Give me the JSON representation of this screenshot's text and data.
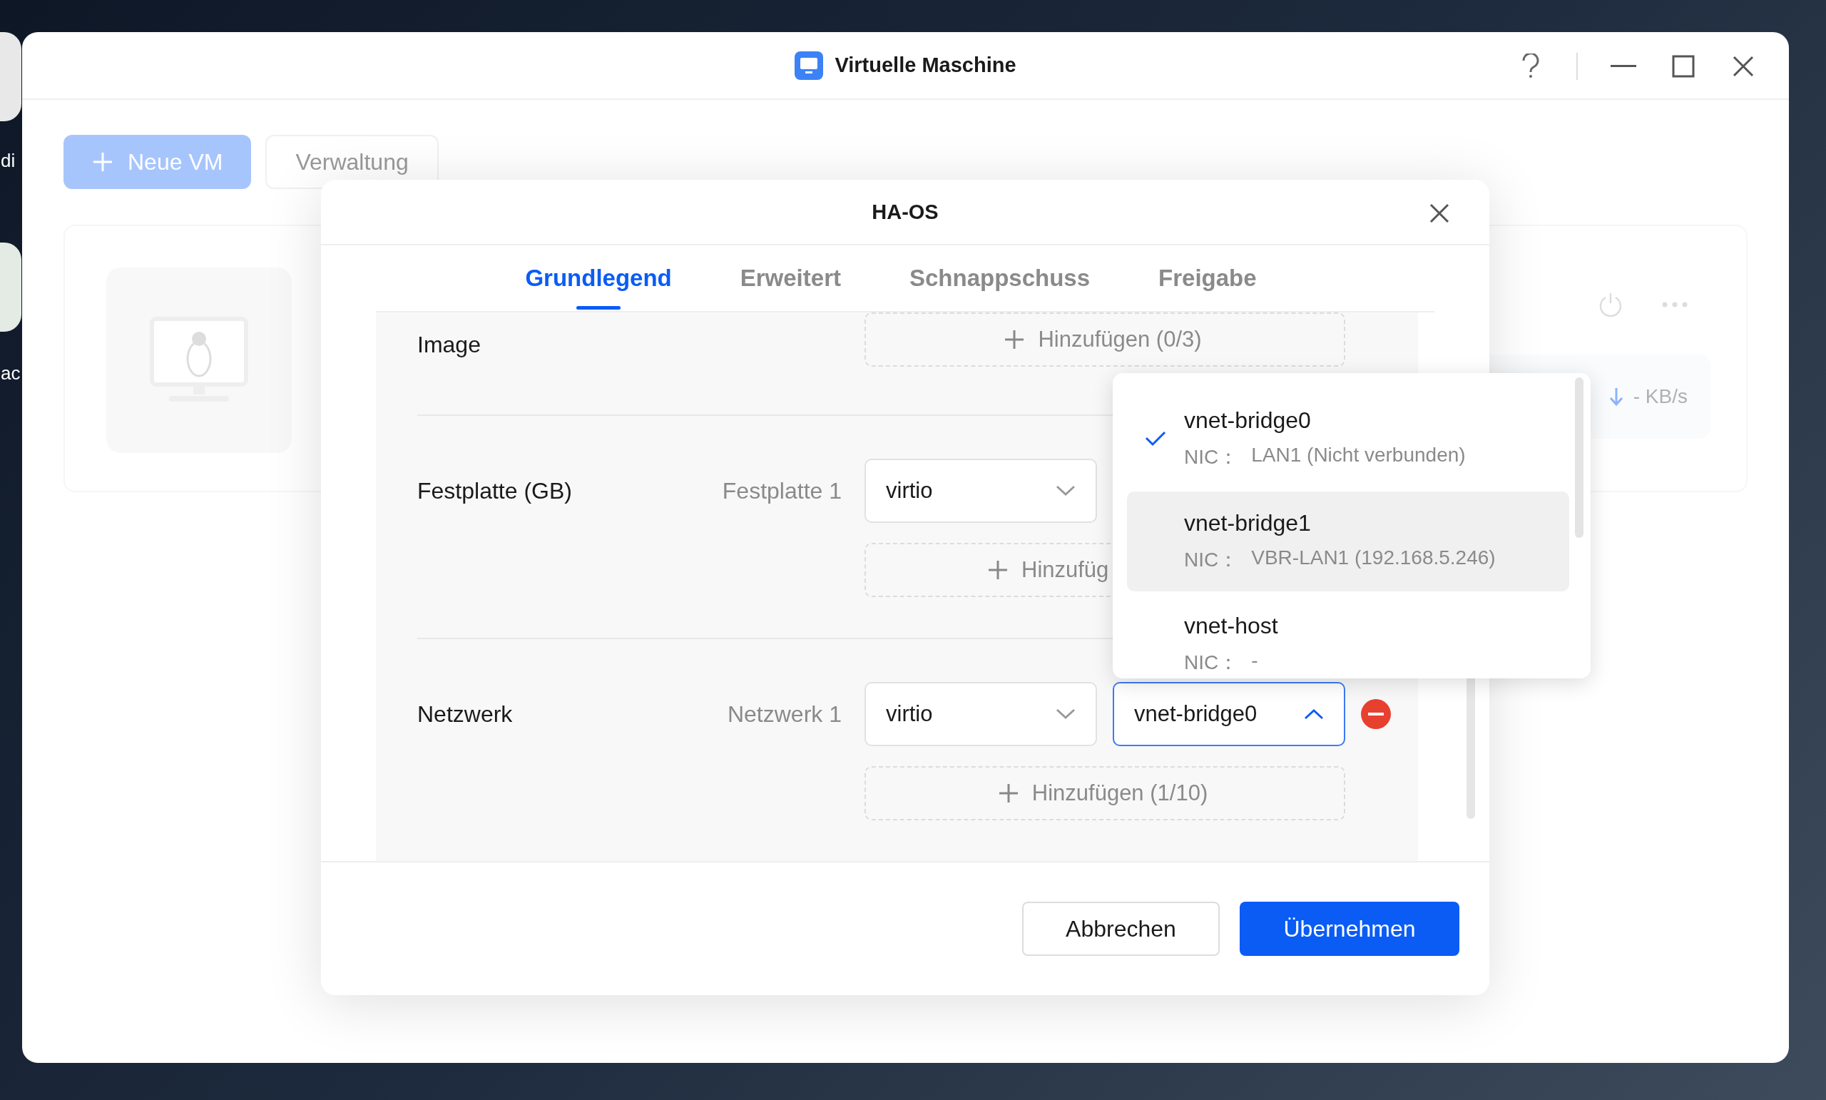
{
  "desktop": {
    "labels": [
      "di",
      "ac"
    ]
  },
  "window": {
    "title": "Virtuelle Maschine"
  },
  "toolbar": {
    "buttons": [
      {
        "label": "Neue VM",
        "kind": "primary"
      },
      {
        "label": "Verwaltung",
        "kind": "secondary"
      }
    ]
  },
  "vm_card": {
    "speed": "- KB/s"
  },
  "dialog": {
    "title": "HA-OS",
    "tabs": [
      {
        "label": "Grundlegend",
        "selected": true
      },
      {
        "label": "Erweitert",
        "selected": false
      },
      {
        "label": "Schnappschuss",
        "selected": false
      },
      {
        "label": "Freigabe",
        "selected": false
      }
    ],
    "sections": [
      {
        "label": "Image",
        "add": "Hinzufügen (0/3)"
      },
      {
        "label": "Festplatte (GB)",
        "item": "Festplatte 1",
        "type": "virtio",
        "add": "Hinzufüg"
      },
      {
        "label": "Netzwerk",
        "item": "Netzwerk 1",
        "type": "virtio",
        "value": "vnet-bridge0",
        "open": true,
        "add": "Hinzufügen (1/10)"
      }
    ],
    "dropdown": {
      "options": [
        {
          "name": "vnet-bridge0",
          "nic_label": "NIC：",
          "nic": "LAN1 (Nicht verbunden)",
          "selected": true,
          "hovered": false
        },
        {
          "name": "vnet-bridge1",
          "nic_label": "NIC：",
          "nic": "VBR-LAN1 (192.168.5.246)",
          "selected": false,
          "hovered": true
        },
        {
          "name": "vnet-host",
          "nic_label": "NIC：",
          "nic": "-",
          "selected": false,
          "hovered": false
        }
      ]
    },
    "buttons": [
      {
        "label": "Abbrechen",
        "kind": "secondary"
      },
      {
        "label": "Übernehmen",
        "kind": "primary"
      }
    ]
  }
}
